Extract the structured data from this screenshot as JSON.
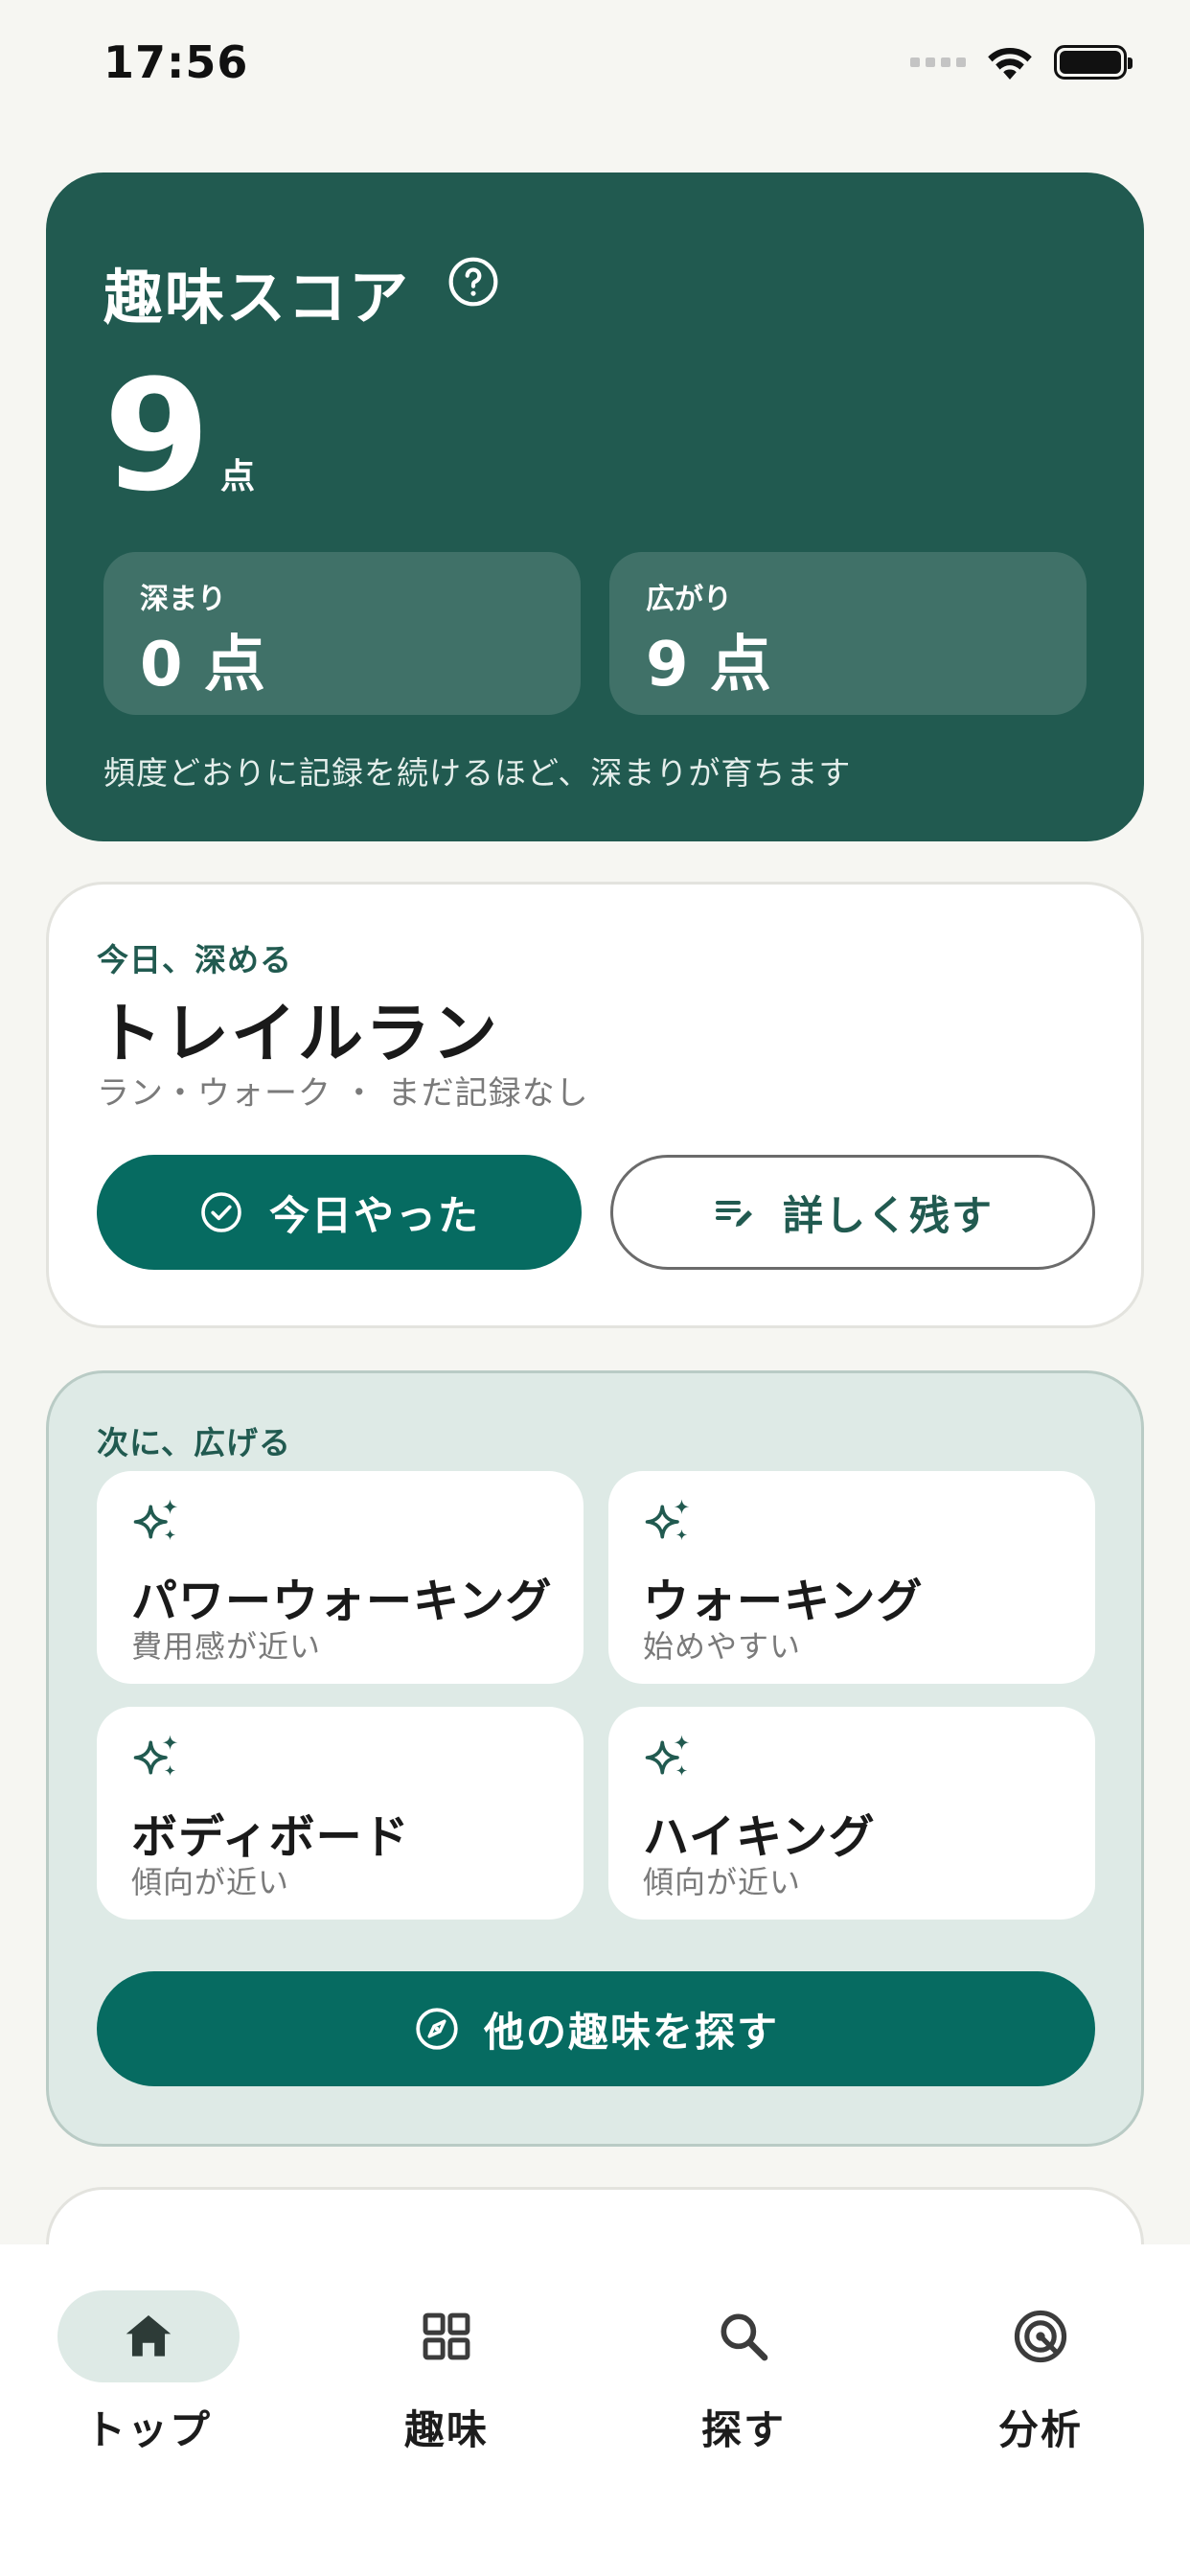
{
  "status_bar": {
    "time": "17:56"
  },
  "score_card": {
    "title": "趣味スコア",
    "score": "9",
    "unit": "点",
    "depth": {
      "label": "深まり",
      "value": "0 点"
    },
    "breadth": {
      "label": "広がり",
      "value": "9 点"
    },
    "note": "頻度どおりに記録を続けるほど、深まりが育ちます"
  },
  "today_card": {
    "label": "今日、深める",
    "title": "トレイルラン",
    "meta": "ラン・ウォーク ・ まだ記録なし",
    "done_button": "今日やった",
    "detail_button": "詳しく残す"
  },
  "expand_card": {
    "label": "次に、広げる",
    "suggestions": [
      {
        "title": "パワーウォーキング",
        "sub": "費用感が近い"
      },
      {
        "title": "ウォーキング",
        "sub": "始めやすい"
      },
      {
        "title": "ボディボード",
        "sub": "傾向が近い"
      },
      {
        "title": "ハイキング",
        "sub": "傾向が近い"
      }
    ],
    "explore_button": "他の趣味を探す"
  },
  "tab_bar": {
    "active": "top",
    "tabs": [
      {
        "label": "トップ",
        "icon": "home-icon"
      },
      {
        "label": "趣味",
        "icon": "grid-icon"
      },
      {
        "label": "探す",
        "icon": "search-icon"
      },
      {
        "label": "分析",
        "icon": "target-icon"
      }
    ]
  },
  "colors": {
    "brand_dark": "#215a50",
    "button_primary": "#066b61",
    "suggest_bg": "#deeae6",
    "page_bg": "#f6f6f2"
  }
}
